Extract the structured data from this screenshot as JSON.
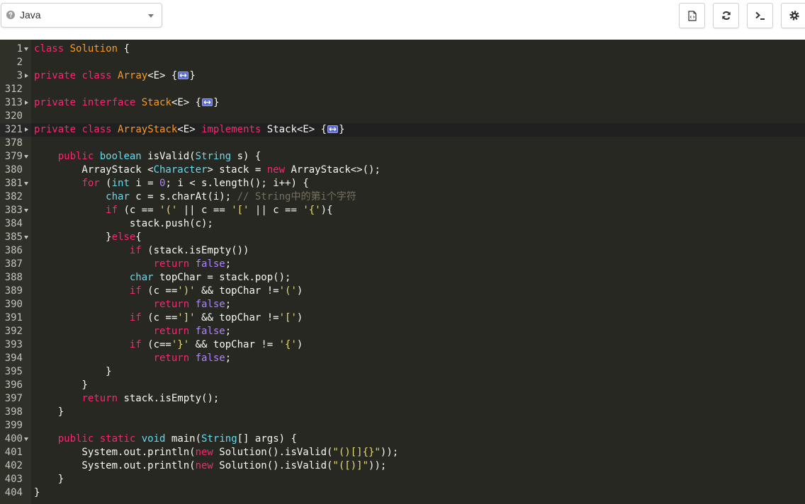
{
  "toolbar": {
    "language": {
      "value": "Java",
      "help_icon": "question-circle-icon",
      "caret_icon": "caret-down-icon"
    },
    "buttons": [
      {
        "icon": "file-code-icon"
      },
      {
        "icon": "refresh-icon"
      },
      {
        "icon": "terminal-icon"
      },
      {
        "icon": "gear-icon"
      }
    ]
  },
  "editor": {
    "theme": {
      "background": "#272822",
      "gutter": "#2F3129",
      "gutter_text": "#C2C3BC",
      "active_line": "#202020",
      "active_gutter": "#272727",
      "plain": "#F8F8F2",
      "keyword": "#F92672",
      "class_name": "#FD971F",
      "type": "#66D9EF",
      "constant": "#AE81FF",
      "string": "#E6DB74",
      "comment": "#75715E",
      "fold_placeholder": "#5A6BD8"
    },
    "lines": [
      {
        "num": 1,
        "fold": "open",
        "tokens": [
          [
            "k",
            "class"
          ],
          [
            "p",
            " "
          ],
          [
            "c",
            "Solution"
          ],
          [
            "p",
            " {"
          ]
        ]
      },
      {
        "num": 2,
        "fold": null,
        "tokens": []
      },
      {
        "num": 3,
        "fold": "closed",
        "tokens": [
          [
            "k",
            "private"
          ],
          [
            "p",
            " "
          ],
          [
            "k",
            "class"
          ],
          [
            "p",
            " "
          ],
          [
            "c",
            "Array"
          ],
          [
            "p",
            "<E> {"
          ],
          [
            "f"
          ],
          [
            "p",
            "}"
          ]
        ]
      },
      {
        "num": 312,
        "fold": null,
        "tokens": []
      },
      {
        "num": 313,
        "fold": "closed",
        "tokens": [
          [
            "k",
            "private"
          ],
          [
            "p",
            " "
          ],
          [
            "k",
            "interface"
          ],
          [
            "p",
            " "
          ],
          [
            "c",
            "Stack"
          ],
          [
            "p",
            "<E> {"
          ],
          [
            "f"
          ],
          [
            "p",
            "}"
          ]
        ]
      },
      {
        "num": 320,
        "fold": null,
        "tokens": []
      },
      {
        "num": 321,
        "fold": "closed",
        "active": true,
        "tokens": [
          [
            "k",
            "private"
          ],
          [
            "p",
            " "
          ],
          [
            "k",
            "class"
          ],
          [
            "p",
            " "
          ],
          [
            "c",
            "ArrayStack"
          ],
          [
            "p",
            "<E> "
          ],
          [
            "k",
            "implements"
          ],
          [
            "p",
            " Stack<E> {"
          ],
          [
            "f"
          ],
          [
            "p",
            "}"
          ]
        ]
      },
      {
        "num": 378,
        "fold": null,
        "tokens": []
      },
      {
        "num": 379,
        "fold": "open",
        "tokens": [
          [
            "p",
            "    "
          ],
          [
            "k",
            "public"
          ],
          [
            "p",
            " "
          ],
          [
            "t",
            "boolean"
          ],
          [
            "p",
            " isValid("
          ],
          [
            "t",
            "String"
          ],
          [
            "p",
            " s) {"
          ]
        ]
      },
      {
        "num": 380,
        "fold": null,
        "tokens": [
          [
            "p",
            "        ArrayStack <"
          ],
          [
            "t",
            "Character"
          ],
          [
            "p",
            "> stack = "
          ],
          [
            "k",
            "new"
          ],
          [
            "p",
            " ArrayStack<>();"
          ]
        ]
      },
      {
        "num": 381,
        "fold": "open",
        "tokens": [
          [
            "p",
            "        "
          ],
          [
            "k",
            "for"
          ],
          [
            "p",
            " ("
          ],
          [
            "t",
            "int"
          ],
          [
            "p",
            " i = "
          ],
          [
            "n",
            "0"
          ],
          [
            "p",
            "; i < s.length(); i++) {"
          ]
        ]
      },
      {
        "num": 382,
        "fold": null,
        "tokens": [
          [
            "p",
            "            "
          ],
          [
            "t",
            "char"
          ],
          [
            "p",
            " c = s.charAt(i); "
          ],
          [
            "m",
            "// String中的第i个字符"
          ]
        ]
      },
      {
        "num": 383,
        "fold": "open",
        "tokens": [
          [
            "p",
            "            "
          ],
          [
            "k",
            "if"
          ],
          [
            "p",
            " (c == "
          ],
          [
            "s",
            "'('"
          ],
          [
            "p",
            " || c == "
          ],
          [
            "s",
            "'['"
          ],
          [
            "p",
            " || c == "
          ],
          [
            "s",
            "'{'"
          ],
          [
            "p",
            "){"
          ]
        ]
      },
      {
        "num": 384,
        "fold": null,
        "tokens": [
          [
            "p",
            "                stack.push(c);"
          ]
        ]
      },
      {
        "num": 385,
        "fold": "open",
        "tokens": [
          [
            "p",
            "            }"
          ],
          [
            "k",
            "else"
          ],
          [
            "p",
            "{"
          ]
        ]
      },
      {
        "num": 386,
        "fold": null,
        "tokens": [
          [
            "p",
            "                "
          ],
          [
            "k",
            "if"
          ],
          [
            "p",
            " (stack.isEmpty())"
          ]
        ]
      },
      {
        "num": 387,
        "fold": null,
        "tokens": [
          [
            "p",
            "                    "
          ],
          [
            "k",
            "return"
          ],
          [
            "p",
            " "
          ],
          [
            "n",
            "false"
          ],
          [
            "p",
            ";"
          ]
        ]
      },
      {
        "num": 388,
        "fold": null,
        "tokens": [
          [
            "p",
            "                "
          ],
          [
            "t",
            "char"
          ],
          [
            "p",
            " topChar = stack.pop();"
          ]
        ]
      },
      {
        "num": 389,
        "fold": null,
        "tokens": [
          [
            "p",
            "                "
          ],
          [
            "k",
            "if"
          ],
          [
            "p",
            " (c =="
          ],
          [
            "s",
            "')'"
          ],
          [
            "p",
            " && topChar !="
          ],
          [
            "s",
            "'('"
          ],
          [
            "p",
            ")"
          ]
        ]
      },
      {
        "num": 390,
        "fold": null,
        "tokens": [
          [
            "p",
            "                    "
          ],
          [
            "k",
            "return"
          ],
          [
            "p",
            " "
          ],
          [
            "n",
            "false"
          ],
          [
            "p",
            ";"
          ]
        ]
      },
      {
        "num": 391,
        "fold": null,
        "tokens": [
          [
            "p",
            "                "
          ],
          [
            "k",
            "if"
          ],
          [
            "p",
            " (c =="
          ],
          [
            "s",
            "']'"
          ],
          [
            "p",
            " && topChar !="
          ],
          [
            "s",
            "'['"
          ],
          [
            "p",
            ")"
          ]
        ]
      },
      {
        "num": 392,
        "fold": null,
        "tokens": [
          [
            "p",
            "                    "
          ],
          [
            "k",
            "return"
          ],
          [
            "p",
            " "
          ],
          [
            "n",
            "false"
          ],
          [
            "p",
            ";"
          ]
        ]
      },
      {
        "num": 393,
        "fold": null,
        "tokens": [
          [
            "p",
            "                "
          ],
          [
            "k",
            "if"
          ],
          [
            "p",
            " (c=="
          ],
          [
            "s",
            "'}'"
          ],
          [
            "p",
            " && topChar != "
          ],
          [
            "s",
            "'{'"
          ],
          [
            "p",
            ")"
          ]
        ]
      },
      {
        "num": 394,
        "fold": null,
        "tokens": [
          [
            "p",
            "                    "
          ],
          [
            "k",
            "return"
          ],
          [
            "p",
            " "
          ],
          [
            "n",
            "false"
          ],
          [
            "p",
            ";"
          ]
        ]
      },
      {
        "num": 395,
        "fold": null,
        "tokens": [
          [
            "p",
            "            }"
          ]
        ]
      },
      {
        "num": 396,
        "fold": null,
        "tokens": [
          [
            "p",
            "        }"
          ]
        ]
      },
      {
        "num": 397,
        "fold": null,
        "tokens": [
          [
            "p",
            "        "
          ],
          [
            "k",
            "return"
          ],
          [
            "p",
            " stack.isEmpty();"
          ]
        ]
      },
      {
        "num": 398,
        "fold": null,
        "tokens": [
          [
            "p",
            "    }"
          ]
        ]
      },
      {
        "num": 399,
        "fold": null,
        "tokens": []
      },
      {
        "num": 400,
        "fold": "open",
        "tokens": [
          [
            "p",
            "    "
          ],
          [
            "k",
            "public"
          ],
          [
            "p",
            " "
          ],
          [
            "k",
            "static"
          ],
          [
            "p",
            " "
          ],
          [
            "t",
            "void"
          ],
          [
            "p",
            " main("
          ],
          [
            "t",
            "String"
          ],
          [
            "p",
            "[] args) {"
          ]
        ]
      },
      {
        "num": 401,
        "fold": null,
        "tokens": [
          [
            "p",
            "        System.out.println("
          ],
          [
            "k",
            "new"
          ],
          [
            "p",
            " Solution().isValid("
          ],
          [
            "s",
            "\"()[]{}\""
          ],
          [
            "p",
            "));"
          ]
        ]
      },
      {
        "num": 402,
        "fold": null,
        "tokens": [
          [
            "p",
            "        System.out.println("
          ],
          [
            "k",
            "new"
          ],
          [
            "p",
            " Solution().isValid("
          ],
          [
            "s",
            "\"([)]\""
          ],
          [
            "p",
            "));"
          ]
        ]
      },
      {
        "num": 403,
        "fold": null,
        "tokens": [
          [
            "p",
            "    }"
          ]
        ]
      },
      {
        "num": 404,
        "fold": null,
        "tokens": [
          [
            "p",
            "}"
          ]
        ]
      }
    ]
  }
}
